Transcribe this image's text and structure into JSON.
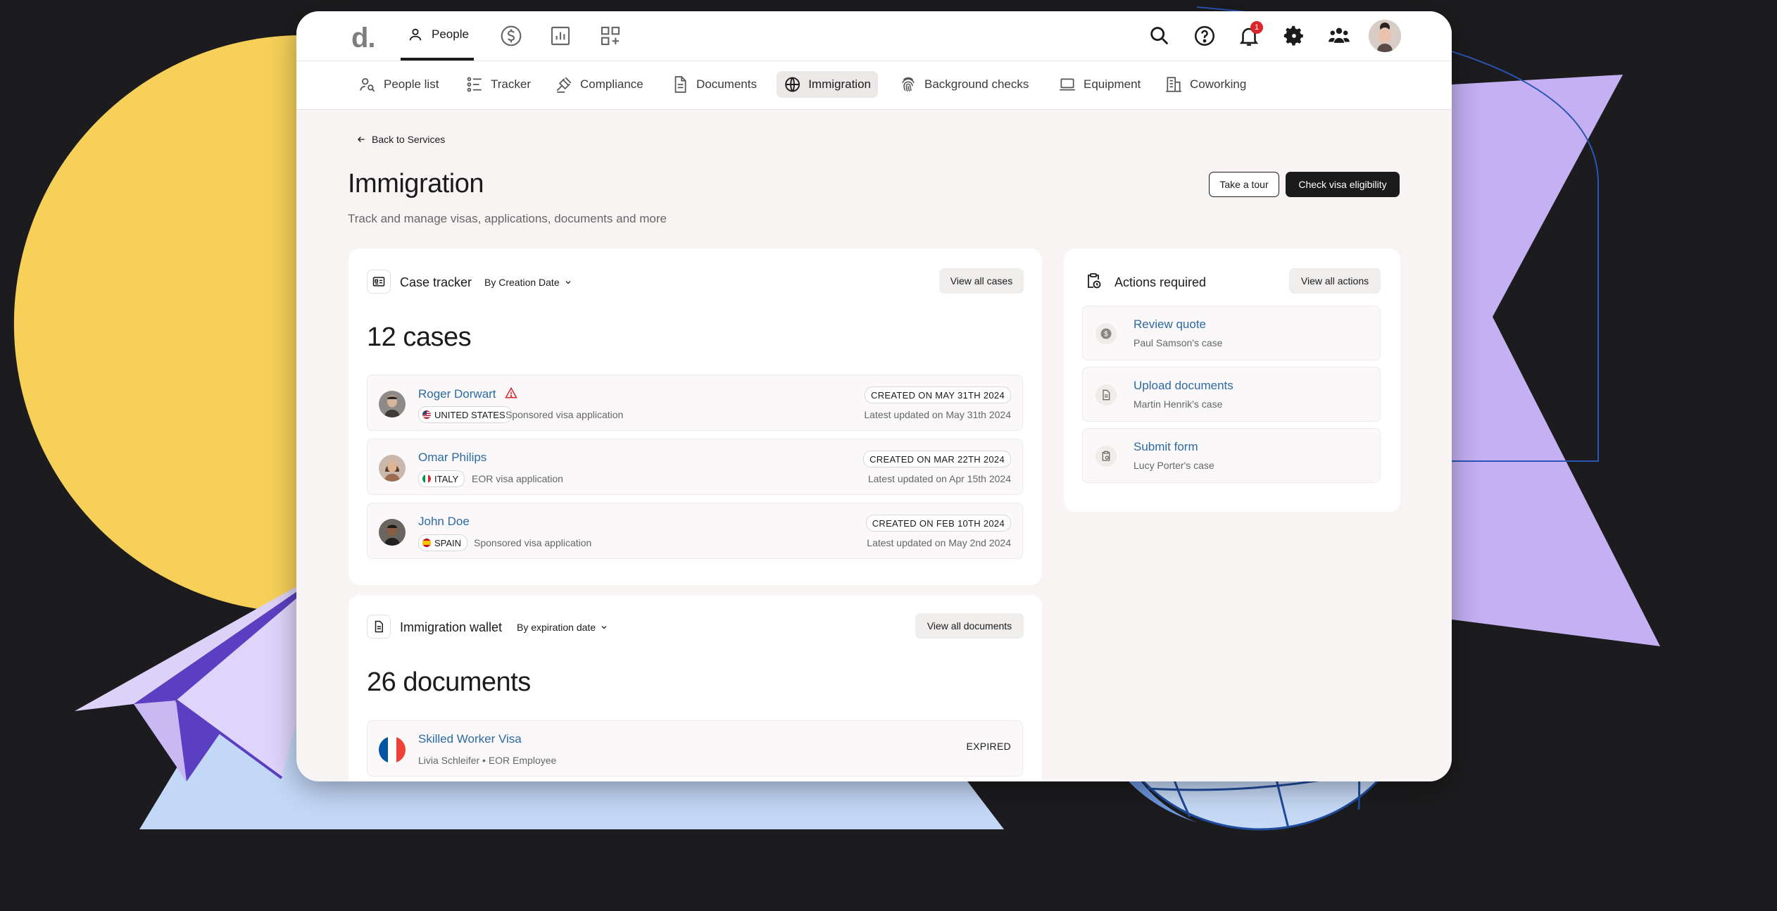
{
  "topnav": {
    "logo": "d.",
    "people_label": "People",
    "notification_count": "1"
  },
  "subnav": {
    "items": [
      {
        "label": "People list"
      },
      {
        "label": "Tracker"
      },
      {
        "label": "Compliance"
      },
      {
        "label": "Documents"
      },
      {
        "label": "Immigration"
      },
      {
        "label": "Background checks"
      },
      {
        "label": "Equipment"
      },
      {
        "label": "Coworking"
      }
    ]
  },
  "page": {
    "back_label": "Back to Services",
    "title": "Immigration",
    "subtitle": "Track and manage visas, applications, documents and more",
    "tour_button": "Take a tour",
    "visa_button": "Check visa eligibility"
  },
  "case_tracker": {
    "title": "Case tracker",
    "sort_label": "By Creation Date",
    "view_all": "View all cases",
    "count": "12 cases",
    "cases": [
      {
        "name": "Roger Dorwart",
        "country": "UNITED STATES",
        "type": "Sponsored visa application",
        "created": "CREATED ON MAY 31TH 2024",
        "updated": "Latest updated on May 31th 2024"
      },
      {
        "name": "Omar Philips",
        "country": "ITALY",
        "type": "EOR visa application",
        "created": "CREATED ON MAR 22TH 2024",
        "updated": "Latest updated on Apr 15th 2024"
      },
      {
        "name": "John Doe",
        "country": "SPAIN",
        "type": "Sponsored visa application",
        "created": "CREATED ON FEB 10TH 2024",
        "updated": "Latest updated on May 2nd 2024"
      }
    ]
  },
  "actions": {
    "title": "Actions required",
    "view_all": "View all actions",
    "items": [
      {
        "title": "Review quote",
        "sub": "Paul Samson's case"
      },
      {
        "title": "Upload documents",
        "sub": "Martin Henrik's case"
      },
      {
        "title": "Submit form",
        "sub": "Lucy Porter's case"
      }
    ]
  },
  "wallet": {
    "title": "Immigration wallet",
    "sort_label": "By expiration date",
    "view_all": "View all documents",
    "count": "26 documents",
    "documents": [
      {
        "name": "Skilled Worker Visa",
        "sub": "Livia Schleifer • EOR Employee",
        "status": "EXPIRED"
      }
    ]
  },
  "colors": {
    "link": "#2d6aa3",
    "primary_button": "#1b1b1b",
    "badge": "#d9262c",
    "deco_yellow": "#f7d05a",
    "deco_purple": "#c4b0f3",
    "deco_blue": "#c3d8f7"
  }
}
